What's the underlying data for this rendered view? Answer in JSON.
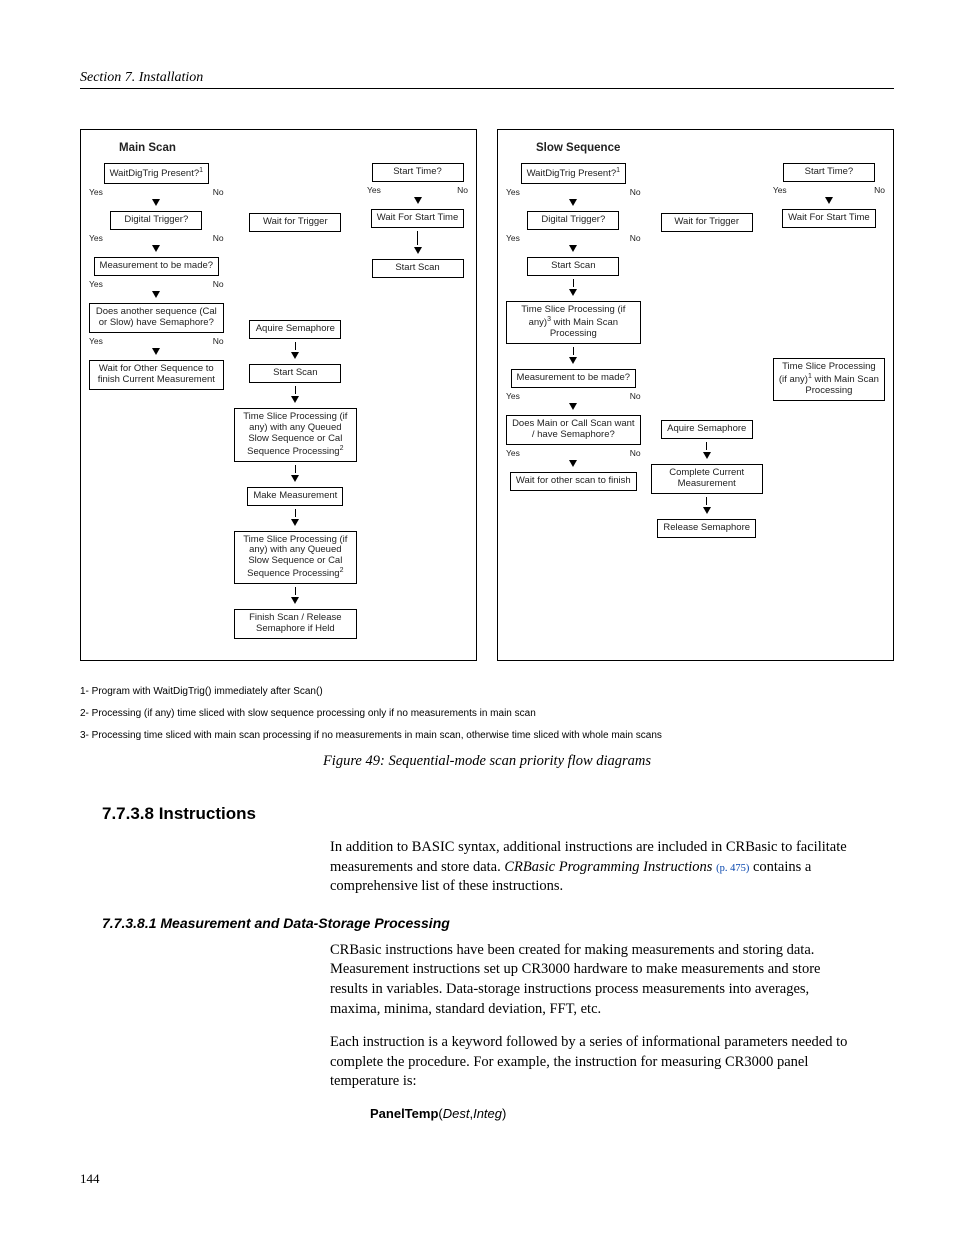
{
  "header": "Section 7.  Installation",
  "page_number": "144",
  "mainScan": {
    "title": "Main Scan",
    "left": {
      "n1": "WaitDigTrig Present?",
      "n1sup": "1",
      "n2": "Digital Trigger?",
      "n3": "Measurement to be made?",
      "n4": "Does another sequence (Cal or Slow) have Semaphore?",
      "n5": "Wait for Other Sequence to finish Current Measurement"
    },
    "mid": {
      "m1": "Aquire Semaphore",
      "m2": "Start Scan",
      "m3": "Time Slice Processing (if any) with any Queued Slow Sequence or Cal Sequence Processing",
      "m3sup": "2",
      "m4": "Make Measurement",
      "m5": "Time Slice Processing (if any) with any Queued Slow Sequence or Cal Sequence Processing",
      "m5sup": "2",
      "m6": "Finish Scan / Release Semaphore if Held",
      "wait": "Wait for Trigger"
    },
    "right": {
      "r1": "Start Time?",
      "r2": "Wait For Start Time",
      "r3": "Start Scan"
    },
    "labels": {
      "yes": "Yes",
      "no": "No"
    }
  },
  "slowSeq": {
    "title": "Slow Sequence",
    "left": {
      "n1": "WaitDigTrig Present?",
      "n1sup": "1",
      "n2": "Digital Trigger?",
      "n3": "Start Scan",
      "n4": "Time Slice Processing (if any)",
      "n4sup": "3",
      "n4b": " with Main Scan Processing",
      "n5": "Measurement to be made?",
      "n6": "Does Main or Call Scan want / have Semaphore?",
      "n7": "Wait for other scan to finish"
    },
    "mid": {
      "wait": "Wait for Trigger",
      "m1": "Aquire Semaphore",
      "m2": "Complete Current Measurement",
      "m3": "Release Semaphore"
    },
    "right": {
      "r1": "Start Time?",
      "r2": "Wait For Start Time",
      "r3": "Time Slice Processing (if any)",
      "r3sup": "1",
      "r3b": " with Main Scan Processing"
    },
    "labels": {
      "yes": "Yes",
      "no": "No"
    }
  },
  "footnotes": {
    "f1": "1- Program with WaitDigTrig() immediately after Scan()",
    "f2": "2- Processing (if any) time sliced with slow sequence processing only if no measurements in main scan",
    "f3": "3- Processing time sliced with main scan processing if no measurements in main scan, otherwise time sliced with whole main scans"
  },
  "figCaption": "Figure 49: Sequential-mode scan priority flow diagrams",
  "sec8": {
    "heading": "7.7.3.8 Instructions",
    "p1a": "In addition to BASIC syntax, additional instructions are included in CRBasic to facilitate measurements and store data. ",
    "p1em": "CRBasic Programming Instructions ",
    "p1link": "(p. 475)",
    "p1b": " contains a comprehensive list of these instructions."
  },
  "sec81": {
    "heading": "7.7.3.8.1 Measurement and Data-Storage Processing",
    "p1": "CRBasic instructions have been created for making measurements and storing data. Measurement instructions set up CR3000 hardware to make measurements and store results in variables. Data-storage instructions process measurements into averages, maxima, minima, standard deviation, FFT, etc.",
    "p2": "Each instruction is a keyword followed by a series of informational parameters needed to complete the procedure. For example, the instruction for measuring CR3000 panel temperature is:",
    "code_kw": "PanelTemp",
    "code_args": "Dest",
    "code_args2": "Integ"
  }
}
